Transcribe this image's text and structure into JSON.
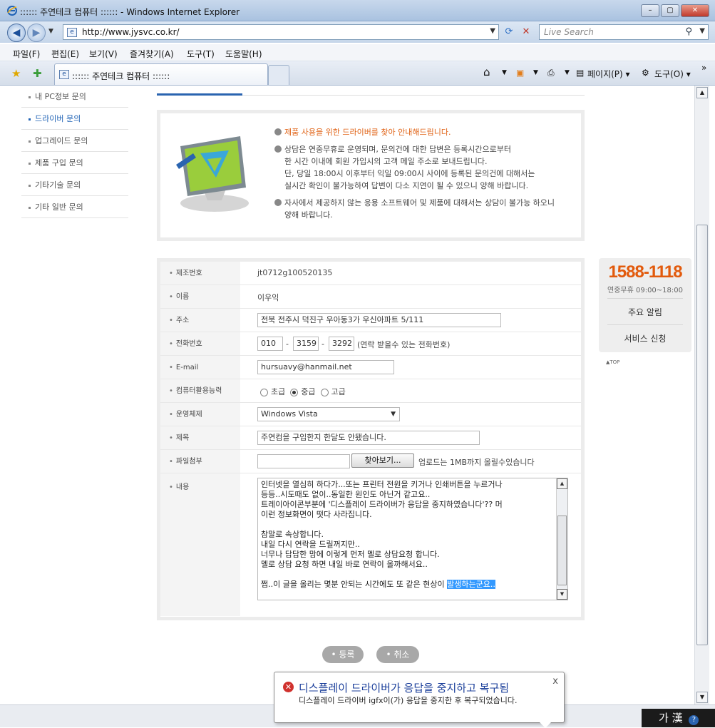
{
  "window": {
    "title": ":::::: 주연테크 컴퓨터 :::::: - Windows Internet Explorer",
    "min": "–",
    "max": "▢",
    "close": "✕"
  },
  "address": {
    "url": "http://www.jysvc.co.kr/",
    "search_placeholder": "Live Search"
  },
  "menu": [
    "파일(F)",
    "편집(E)",
    "보기(V)",
    "즐겨찾기(A)",
    "도구(T)",
    "도움말(H)"
  ],
  "tab": {
    "label": ":::::: 주연테크 컴퓨터 ::::::"
  },
  "commands": {
    "page": "페이지(P) ▾",
    "tools": "도구(O) ▾"
  },
  "sidenav": [
    {
      "label": "내 PC정보 문의",
      "active": false
    },
    {
      "label": "드라이버 문의",
      "active": true
    },
    {
      "label": "업그레이드 문의",
      "active": false
    },
    {
      "label": "제품 구입 문의",
      "active": false
    },
    {
      "label": "기타기술 문의",
      "active": false
    },
    {
      "label": "기타 일반 문의",
      "active": false
    }
  ],
  "info": {
    "line1": "제품 사용을 위한 드라이버를 찾아 안내해드립니다.",
    "line2": "상담은 연중무휴로 운영되며, 문의건에 대한 답변은 등록시간으로부터\n한 시간 이내에 회원 가입시의 고객 메일 주소로 보내드립니다.\n단, 당일 18:00시 이후부터 익일 09:00시 사이에 등록된 문의건에 대해서는\n실시간 확인이 불가능하여 답변이 다소 지연이 될 수 있으니 양해 바랍니다.",
    "line3": "자사에서 제공하지 않는 응용 소프트웨어 및 제품에 대해서는 상담이 불가능 하오니\n양해 바랍니다."
  },
  "form": {
    "serial_label": "제조번호",
    "serial": "jt0712g100520135",
    "name_label": "이름",
    "name": "이우익",
    "address_label": "주소",
    "address": "전북 전주시 덕진구 우아동3가  우신아파트 5/111",
    "phone_label": "전화번호",
    "phone1": "010",
    "phone2": "3159",
    "phone3": "3292",
    "phone_dash": "-",
    "phone_note": "(연락 받을수 있는 전화번호)",
    "email_label": "E-mail",
    "email": "hursuavy@hanmail.net",
    "skill_label": "컴퓨터활용능력",
    "skill_options": [
      "초급",
      "중급",
      "고급"
    ],
    "skill_selected": "중급",
    "os_label": "운영체제",
    "os": "Windows Vista",
    "subject_label": "제목",
    "subject": "주연컴을 구입한지 한달도 안됐습니다.",
    "file_label": "파일첨부",
    "browse": "찾아보기...",
    "file_note": "업로드는 1MB까지 올릴수있습니다",
    "content_label": "내용",
    "content": "인터넷을 열심히 하다가...또는 프린터 전원을 키거나 인쇄버튼을 누르거나\n등등..시도때도 없이..동일한 원인도 아닌거 같고요..\n트레이아이콘부분에 '디스플레이 드라이버가 응답을 중지하였습니다'?? 머\n이런 정보화면이 떳다 사라집니다.\n\n참말로 속상합니다.\n내일 다시 연락을 드릴꺼지만..\n너무나 답답한 맘에 이렇게 먼저 멜로 상담요청 합니다.\n멜로 상담 요청 하면 내일 바로 연락이 올까해서요..\n\n쩝..이 글을 올리는 몇분 안되는 시간에도 또 같은 현상이 ",
    "content_selected": "발생하는군요.."
  },
  "side": {
    "phone": "1588-1118",
    "hours": "연중무휴 09:00~18:00",
    "notice": "주요 알림",
    "service": "서비스 신청",
    "top": "▲TOP"
  },
  "buttons": {
    "submit": "• 등록",
    "cancel": "• 취소"
  },
  "balloon": {
    "title": "디스플레이 드라이버가 응답을 중지하고 복구됨",
    "message": "디스플레이 드라이버 igfx이(가) 응답을 중지한 후 복구되었습니다.",
    "close": "x"
  },
  "ime": {
    "text": "가 漢",
    "help": "?"
  },
  "colors": {
    "accent_orange": "#e25a0c",
    "link_blue": "#1f62b5",
    "error_red": "#d0312d"
  }
}
